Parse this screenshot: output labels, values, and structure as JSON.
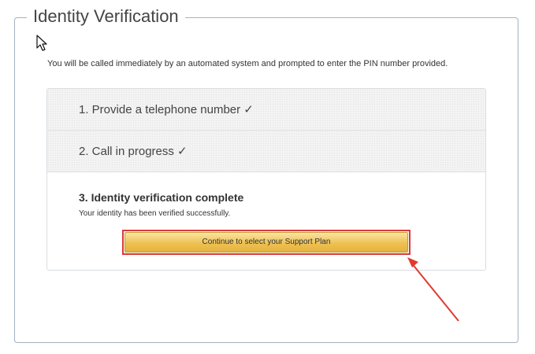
{
  "dialog": {
    "title": "Identity Verification",
    "intro": "You will be called immediately by an automated system and prompted to enter the PIN number provided."
  },
  "steps": [
    {
      "label": "1. Provide a telephone number ✓",
      "state": "completed"
    },
    {
      "label": "2. Call in progress ✓",
      "state": "completed"
    },
    {
      "label": "3. Identity verification complete",
      "state": "active",
      "description": "Your identity has been verified successfully.",
      "button_label": "Continue to select your Support Plan"
    }
  ],
  "colors": {
    "highlight": "#d9383d",
    "button": "#eec153",
    "border": "#a3b2c0"
  },
  "icons": {
    "pointer": "mouse-pointer-icon",
    "annotation": "red-arrow-icon"
  }
}
